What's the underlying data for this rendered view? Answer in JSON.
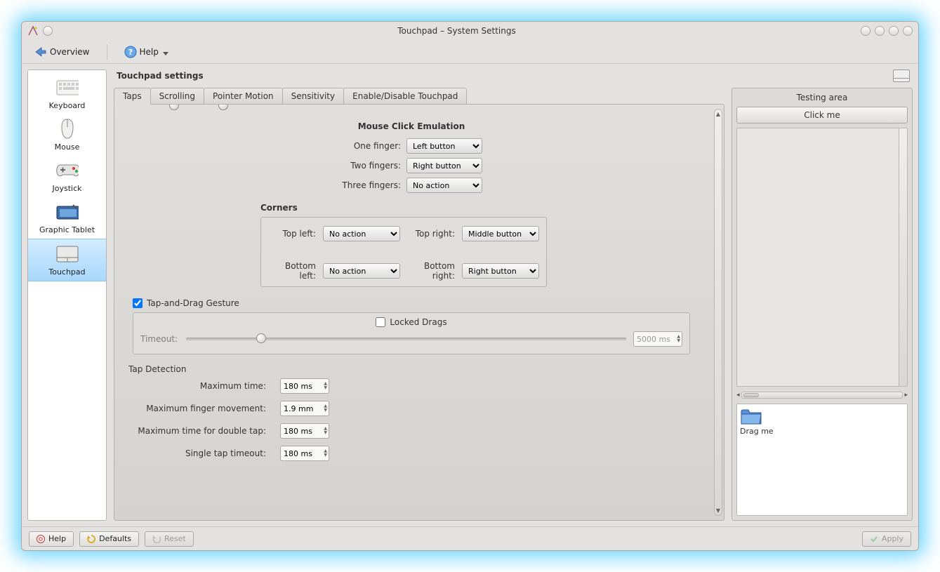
{
  "window": {
    "title": "Touchpad – System Settings"
  },
  "toolbar": {
    "overview": "Overview",
    "help": "Help"
  },
  "sidebar": {
    "items": [
      {
        "label": "Keyboard"
      },
      {
        "label": "Mouse"
      },
      {
        "label": "Joystick"
      },
      {
        "label": "Graphic Tablet"
      },
      {
        "label": "Touchpad"
      }
    ]
  },
  "header": {
    "title": "Touchpad settings"
  },
  "tabs": [
    {
      "label": "Taps"
    },
    {
      "label": "Scrolling"
    },
    {
      "label": "Pointer Motion"
    },
    {
      "label": "Sensitivity"
    },
    {
      "label": "Enable/Disable Touchpad"
    }
  ],
  "emulation": {
    "title": "Mouse Click Emulation",
    "one_finger_label": "One finger:",
    "one_finger_value": "Left button",
    "two_fingers_label": "Two fingers:",
    "two_fingers_value": "Right button",
    "three_fingers_label": "Three fingers:",
    "three_fingers_value": "No action"
  },
  "corners": {
    "title": "Corners",
    "top_left_label": "Top left:",
    "top_left_value": "No action",
    "top_right_label": "Top right:",
    "top_right_value": "Middle button",
    "bottom_left_label": "Bottom left:",
    "bottom_left_value": "No action",
    "bottom_right_label": "Bottom right:",
    "bottom_right_value": "Right button"
  },
  "tap_drag": {
    "label": "Tap-and-Drag Gesture",
    "locked_label": "Locked Drags",
    "timeout_label": "Timeout:",
    "timeout_value": "5000 ms"
  },
  "tap_detection": {
    "title": "Tap Detection",
    "max_time_label": "Maximum time:",
    "max_time_value": "180 ms",
    "max_finger_label": "Maximum finger movement:",
    "max_finger_value": "1.9 mm",
    "max_dbl_label": "Maximum time for double tap:",
    "max_dbl_value": "180 ms",
    "single_tap_label": "Single tap timeout:",
    "single_tap_value": "180 ms"
  },
  "testing": {
    "title": "Testing area",
    "click_me": "Click me",
    "drag_me": "Drag me"
  },
  "footer": {
    "help": "Help",
    "defaults": "Defaults",
    "reset": "Reset",
    "apply": "Apply"
  }
}
